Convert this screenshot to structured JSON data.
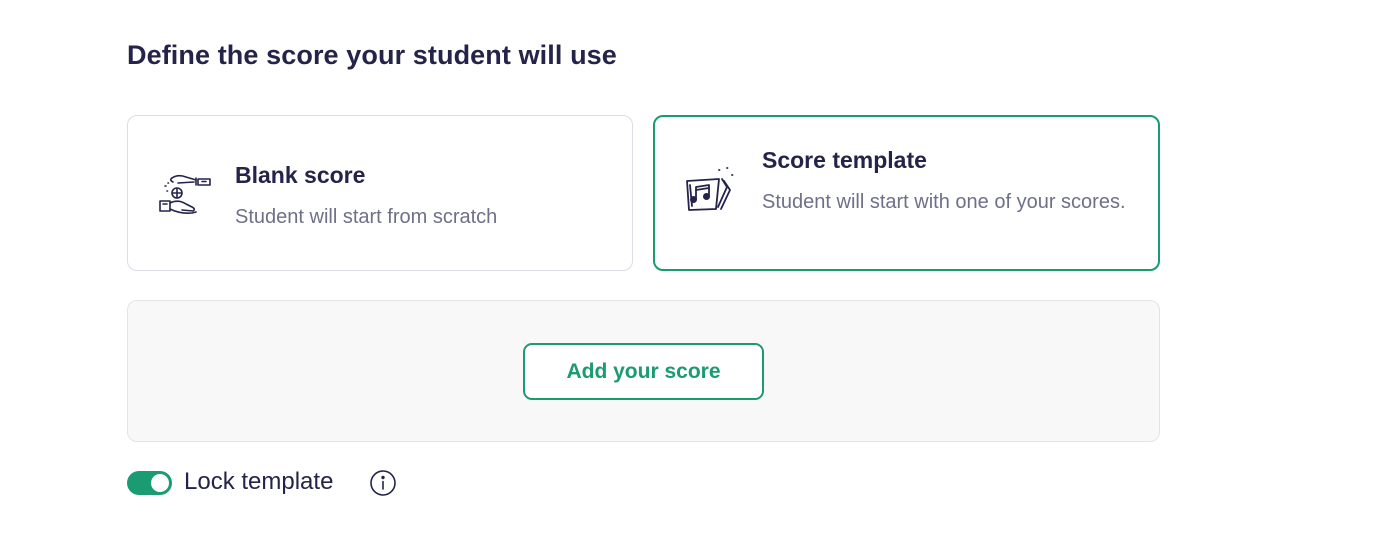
{
  "heading": "Define the score your student will use",
  "options": [
    {
      "title": "Blank score",
      "description": "Student will start from scratch",
      "icon": "hands-plus-icon",
      "selected": false
    },
    {
      "title": "Score template",
      "description": "Student will start with one of your scores.",
      "icon": "sheet-music-icon",
      "selected": true
    }
  ],
  "add_score": {
    "label": "Add your score"
  },
  "lock_template": {
    "label": "Lock template",
    "enabled": true,
    "info_icon": "info-icon"
  },
  "colors": {
    "accent": "#1a9b71",
    "heading": "#24234a",
    "muted_text": "#6e7089",
    "card_border": "#dcdee6",
    "panel_background": "#f8f8f9"
  }
}
